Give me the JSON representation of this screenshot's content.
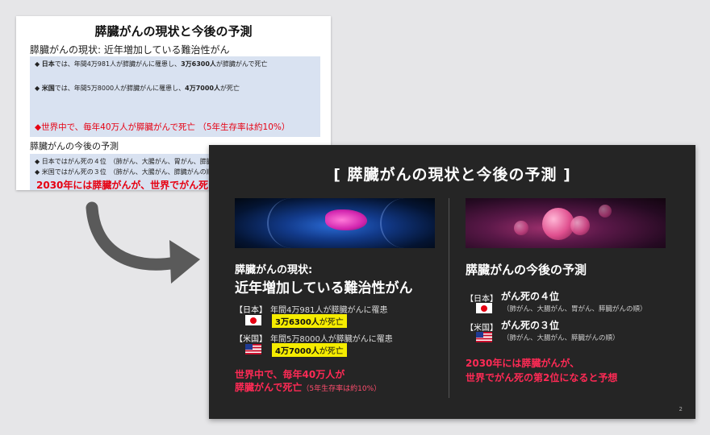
{
  "before_slide": {
    "title": "膵臓がんの現状と今後の予測",
    "subtitle1": "膵臓がんの現状: 近年増加している難治性がん",
    "line_japan": {
      "bullet": "◆",
      "country": "日本",
      "text_a": "では、年間4万981人が膵臓がんに罹患し、",
      "bold": "3万6300人",
      "text_b": "が膵臓がんで死亡"
    },
    "line_us": {
      "bullet": "◆",
      "country": "米国",
      "text_a": "では、年間5万8000人が膵臓がんに罹患し、",
      "bold": "4万7000人",
      "text_b": "が死亡"
    },
    "red_line": "◆世界中で、毎年40万人が膵臓がんで死亡 （5年生存率は約10%）",
    "subtitle2": "膵臓がんの今後の予測",
    "line_rank_jp": "◆ 日本ではがん死の４位　（肺がん、大腸がん、胃がん、膵臓がんの順）",
    "line_rank_us": "◆ 米国ではがん死の３位　（肺がん、大腸がん、膵臓がんの順）",
    "red_bottom": "2030年には膵臓がんが、世界でがん死の第2位になると予想"
  },
  "after_slide": {
    "title": "[ 膵臓がんの現状と今後の予測 ]",
    "left": {
      "heading_small": "膵臓がんの現状:",
      "heading_large": "近年増加している難治性がん",
      "japan": {
        "label": "【日本】",
        "text": "年間4万981人が膵臓がんに罹患",
        "highlight_bold": "3万6300人",
        "highlight_rest": "が死亡"
      },
      "us": {
        "label": "【米国】",
        "text": "年間5万8000人が膵臓がんに罹患",
        "highlight_bold": "4万7000人",
        "highlight_rest": "が死亡"
      },
      "red_line1": "世界中で、毎年40万人が",
      "red_line2": "膵臓がんで死亡",
      "red_small": "（5年生存率は約10%）"
    },
    "right": {
      "heading": "膵臓がんの今後の予測",
      "japan": {
        "label": "【日本】",
        "rank": "がん死の４位",
        "detail": "（肺がん、大腸がん、胃がん、膵臓がんの順）"
      },
      "us": {
        "label": "【米国】",
        "rank": "がん死の３位",
        "detail": "（肺がん、大腸がん、膵臓がんの順）"
      },
      "red_line1": "2030年には膵臓がんが、",
      "red_line2": "世界でがん死の第2位になると予想"
    },
    "page_number": "2"
  },
  "colors": {
    "accent_red": "#e60012",
    "dark_red": "#ff2a55",
    "highlight_yellow": "#f5ec00",
    "dark_bg": "#252525",
    "light_box": "#d9e2f1"
  },
  "icons": [
    "curved-arrow-icon",
    "japan-flag-icon",
    "us-flag-icon"
  ]
}
